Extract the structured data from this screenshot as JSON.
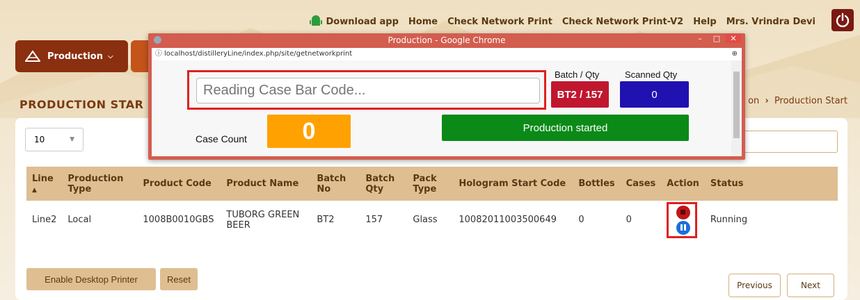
{
  "topnav": {
    "download": "Download app",
    "home": "Home",
    "check_network_print": "Check Network Print",
    "check_network_print_v2": "Check Network Print-V2",
    "help": "Help",
    "user": "Mrs. Vrindra Devi"
  },
  "menu": {
    "production_label": "Production"
  },
  "page": {
    "title": "PRODUCTION STAR",
    "breadcrumb_prev": "on",
    "breadcrumb_current": "Production Start"
  },
  "table_controls": {
    "page_length": "10"
  },
  "table": {
    "headers": [
      "Line",
      "Production Type",
      "Product Code",
      "Product Name",
      "Batch No",
      "Batch Qty",
      "Pack Type",
      "Hologram Start Code",
      "Bottles",
      "Cases",
      "Action",
      "Status"
    ],
    "rows": [
      {
        "line": "Line2",
        "production_type": "Local",
        "product_code": "1008B0010GBS",
        "product_name": "TUBORG GREEN BEER",
        "batch_no": "BT2",
        "batch_qty": "157",
        "pack_type": "Glass",
        "hologram_start_code": "10082011003500649",
        "bottles": "0",
        "cases": "0",
        "status": "Running"
      }
    ]
  },
  "buttons": {
    "enable_printer": "Enable Desktop Printer",
    "reset": "Reset",
    "previous": "Previous",
    "next": "Next"
  },
  "popup": {
    "window_title": "Production - Google Chrome",
    "url": "localhost/distilleryLine/index.php/site/getnetworkprint",
    "barcode_placeholder": "Reading Case Bar Code...",
    "batch_qty_label": "Batch / Qty",
    "batch_qty_value": "BT2 / 157",
    "scanned_qty_label": "Scanned Qty",
    "scanned_qty_value": "0",
    "case_count_label": "Case Count",
    "case_count_value": "0",
    "status_text": "Production started"
  },
  "colors": {
    "brand_brown": "#8a2f0f",
    "header_tan": "#dfbe92",
    "popup_titlebar": "#d35d4e",
    "highlight_red": "#e0201f",
    "batch_badge": "#c0172f",
    "scanned_badge": "#1f12b0",
    "case_badge": "#ffa100",
    "status_green": "#0b8a18"
  }
}
